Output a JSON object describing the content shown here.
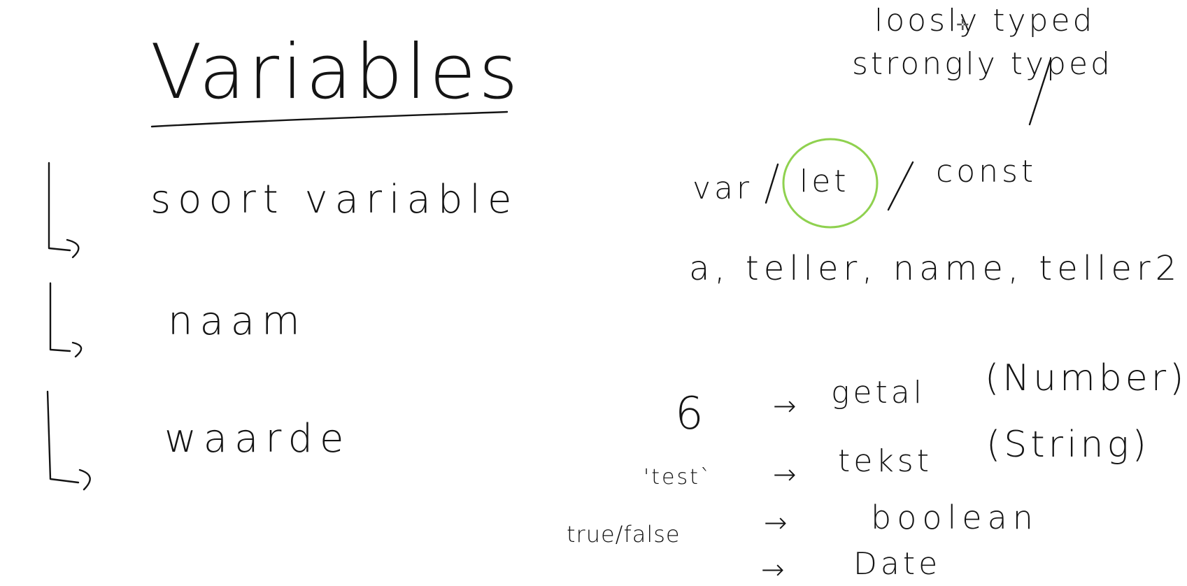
{
  "title": "Variables",
  "items": [
    "soort variable",
    "naam",
    "waarde"
  ],
  "typing": [
    "loosly typed",
    "strongly typed"
  ],
  "keywords": {
    "var": "var",
    "let": "let",
    "const": "const",
    "separator": "/"
  },
  "names_example": "a, teller, name, teller2",
  "examples": [
    {
      "value": "6",
      "type": "getal",
      "name": "(Number)"
    },
    {
      "value": "'test`",
      "type": "tekst",
      "name": "(String)"
    },
    {
      "value": "true/false",
      "type": "boolean",
      "name": ""
    },
    {
      "value": "",
      "type": "Date",
      "name": ""
    }
  ],
  "arrow_glyph": "→",
  "highlight_color": "#8fd14f",
  "ink_color": "#141414",
  "icons": {
    "cursor": "crosshair-cursor-icon"
  }
}
